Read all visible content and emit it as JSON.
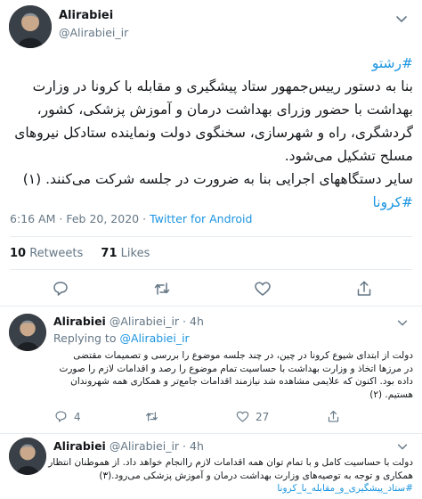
{
  "main_tweet": {
    "name": "Alirabiei",
    "handle": "@Alirabiei_ir",
    "hashtag_top": "#رشتو",
    "body_lines": [
      "بنا به دستور رییس‌جمهور ستاد پیشگیری و مقابله با کرونا در وزارت",
      "بهداشت با حضور وزرای بهداشت درمان و آموزش پزشکی، کشور،",
      "گردشگری، راه و شهرسازی، سخنگوی دولت ونماینده ستادکل نیروهای",
      "مسلح تشکیل می‌شود.",
      "سایر دستگاههای اجرایی بنا به ضرورت در جلسه شرکت می‌کنند. (۱)"
    ],
    "hashtag_bottom": "#کرونا",
    "time": "6:16 AM",
    "date": "Feb 20, 2020",
    "client": "Twitter for Android",
    "retweets_count": "10",
    "retweets_label": "Retweets",
    "likes_count": "71",
    "likes_label": "Likes",
    "dot": "·",
    "accent": "#1b95e0"
  },
  "replies": [
    {
      "name": "Alirabiei",
      "handle": "@Alirabiei_ir",
      "age": "· 4h",
      "replying_prefix": "Replying to",
      "replying_to": "@Alirabiei_ir",
      "body_lines": [
        "دولت از ابتدای شیوع کرونا در چین، در چند جلسه موضوع را بررسی و تصمیمات مقتضی",
        "در مرزها اتخاذ و وزارت بهداشت با حساسیت تمام موضوع را رصد و اقدامات لازم را صورت",
        "داده بود. اکنون که علایمی مشاهده شد نیازمند اقدامات جامع‌تر و همکاری همه شهروندان",
        "هستیم. (۲)"
      ],
      "reply_count": "4",
      "retweet_count": "",
      "like_count": "27"
    },
    {
      "name": "Alirabiei",
      "handle": "@Alirabiei_ir",
      "age": "· 4h",
      "body_lines": [
        "دولت با حساسیت کامل و با تمام توان همه اقدامات لازم راانجام خواهد داد. از هموطنان انتظار",
        "همکاری و توجه به توصیه‌های وزارت بهداشت درمان و آموزش پزشکی می‌رود.(۳)"
      ],
      "hashtag": "#ستاد_پیشگیری_و_مقابله_با_کرونا"
    }
  ]
}
